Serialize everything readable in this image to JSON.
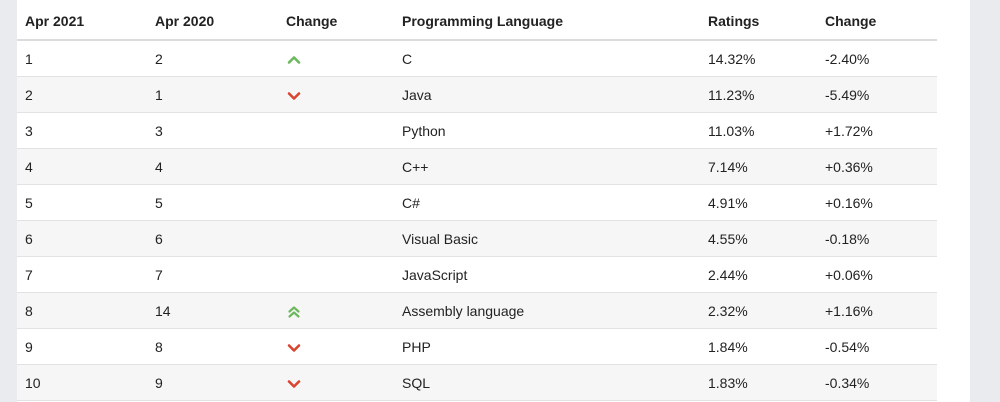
{
  "colors": {
    "up": "#6cb85c",
    "down": "#d9462f"
  },
  "table": {
    "headers": [
      "Apr 2021",
      "Apr 2020",
      "Change",
      "Programming Language",
      "Ratings",
      "Change"
    ],
    "rows": [
      {
        "apr2021": "1",
        "apr2020": "2",
        "trend": "up",
        "language": "C",
        "rating": "14.32%",
        "change": "-2.40%"
      },
      {
        "apr2021": "2",
        "apr2020": "1",
        "trend": "down",
        "language": "Java",
        "rating": "11.23%",
        "change": "-5.49%"
      },
      {
        "apr2021": "3",
        "apr2020": "3",
        "trend": "none",
        "language": "Python",
        "rating": "11.03%",
        "change": "+1.72%"
      },
      {
        "apr2021": "4",
        "apr2020": "4",
        "trend": "none",
        "language": "C++",
        "rating": "7.14%",
        "change": "+0.36%"
      },
      {
        "apr2021": "5",
        "apr2020": "5",
        "trend": "none",
        "language": "C#",
        "rating": "4.91%",
        "change": "+0.16%"
      },
      {
        "apr2021": "6",
        "apr2020": "6",
        "trend": "none",
        "language": "Visual Basic",
        "rating": "4.55%",
        "change": "-0.18%"
      },
      {
        "apr2021": "7",
        "apr2020": "7",
        "trend": "none",
        "language": "JavaScript",
        "rating": "2.44%",
        "change": "+0.06%"
      },
      {
        "apr2021": "8",
        "apr2020": "14",
        "trend": "double-up",
        "language": "Assembly language",
        "rating": "2.32%",
        "change": "+1.16%"
      },
      {
        "apr2021": "9",
        "apr2020": "8",
        "trend": "down",
        "language": "PHP",
        "rating": "1.84%",
        "change": "-0.54%"
      },
      {
        "apr2021": "10",
        "apr2020": "9",
        "trend": "down",
        "language": "SQL",
        "rating": "1.83%",
        "change": "-0.34%"
      }
    ]
  }
}
